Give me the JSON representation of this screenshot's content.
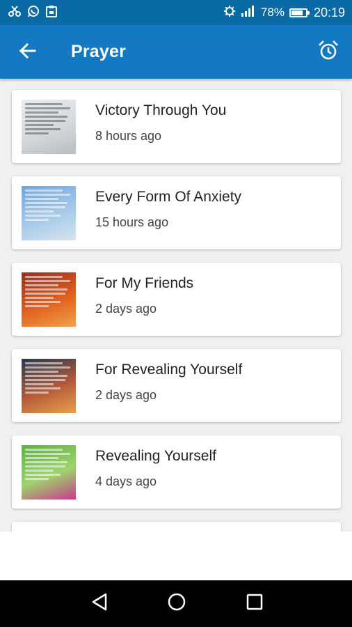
{
  "status_bar": {
    "left_icons": [
      "scissors-icon",
      "whatsapp-icon",
      "clipboard-icon"
    ],
    "right_icons": [
      "gear-icon",
      "signal-icon",
      "battery-icon"
    ],
    "battery": "78%",
    "battery_level": 0.78,
    "time": "20:19"
  },
  "app_bar": {
    "title": "Prayer",
    "back_icon": "arrow-left-icon",
    "alarm_icon": "alarm-clock-icon",
    "color": "#1279c2"
  },
  "prayers": [
    {
      "title": "Victory Through You",
      "time": "8 hours ago",
      "thumb_colors": [
        "#e9ecef",
        "#d5d9de",
        "#b9bcc0"
      ]
    },
    {
      "title": "Every Form Of Anxiety",
      "time": "15 hours ago",
      "thumb_colors": [
        "#6aa7df",
        "#a6c9ea",
        "#d7e4ee"
      ]
    },
    {
      "title": "For My Friends",
      "time": "2 days ago",
      "thumb_colors": [
        "#a02a1c",
        "#e0601f",
        "#f2a24a"
      ]
    },
    {
      "title": "For Revealing Yourself",
      "time": "2 days ago",
      "thumb_colors": [
        "#27384e",
        "#b55a3a",
        "#e8a14a"
      ]
    },
    {
      "title": "Revealing Yourself",
      "time": "4 days ago",
      "thumb_colors": [
        "#58b340",
        "#9ed46a",
        "#c83a8e"
      ]
    }
  ],
  "nav_bar": {
    "back_icon": "triangle-back-icon",
    "home_icon": "circle-home-icon",
    "recents_icon": "square-recents-icon"
  }
}
